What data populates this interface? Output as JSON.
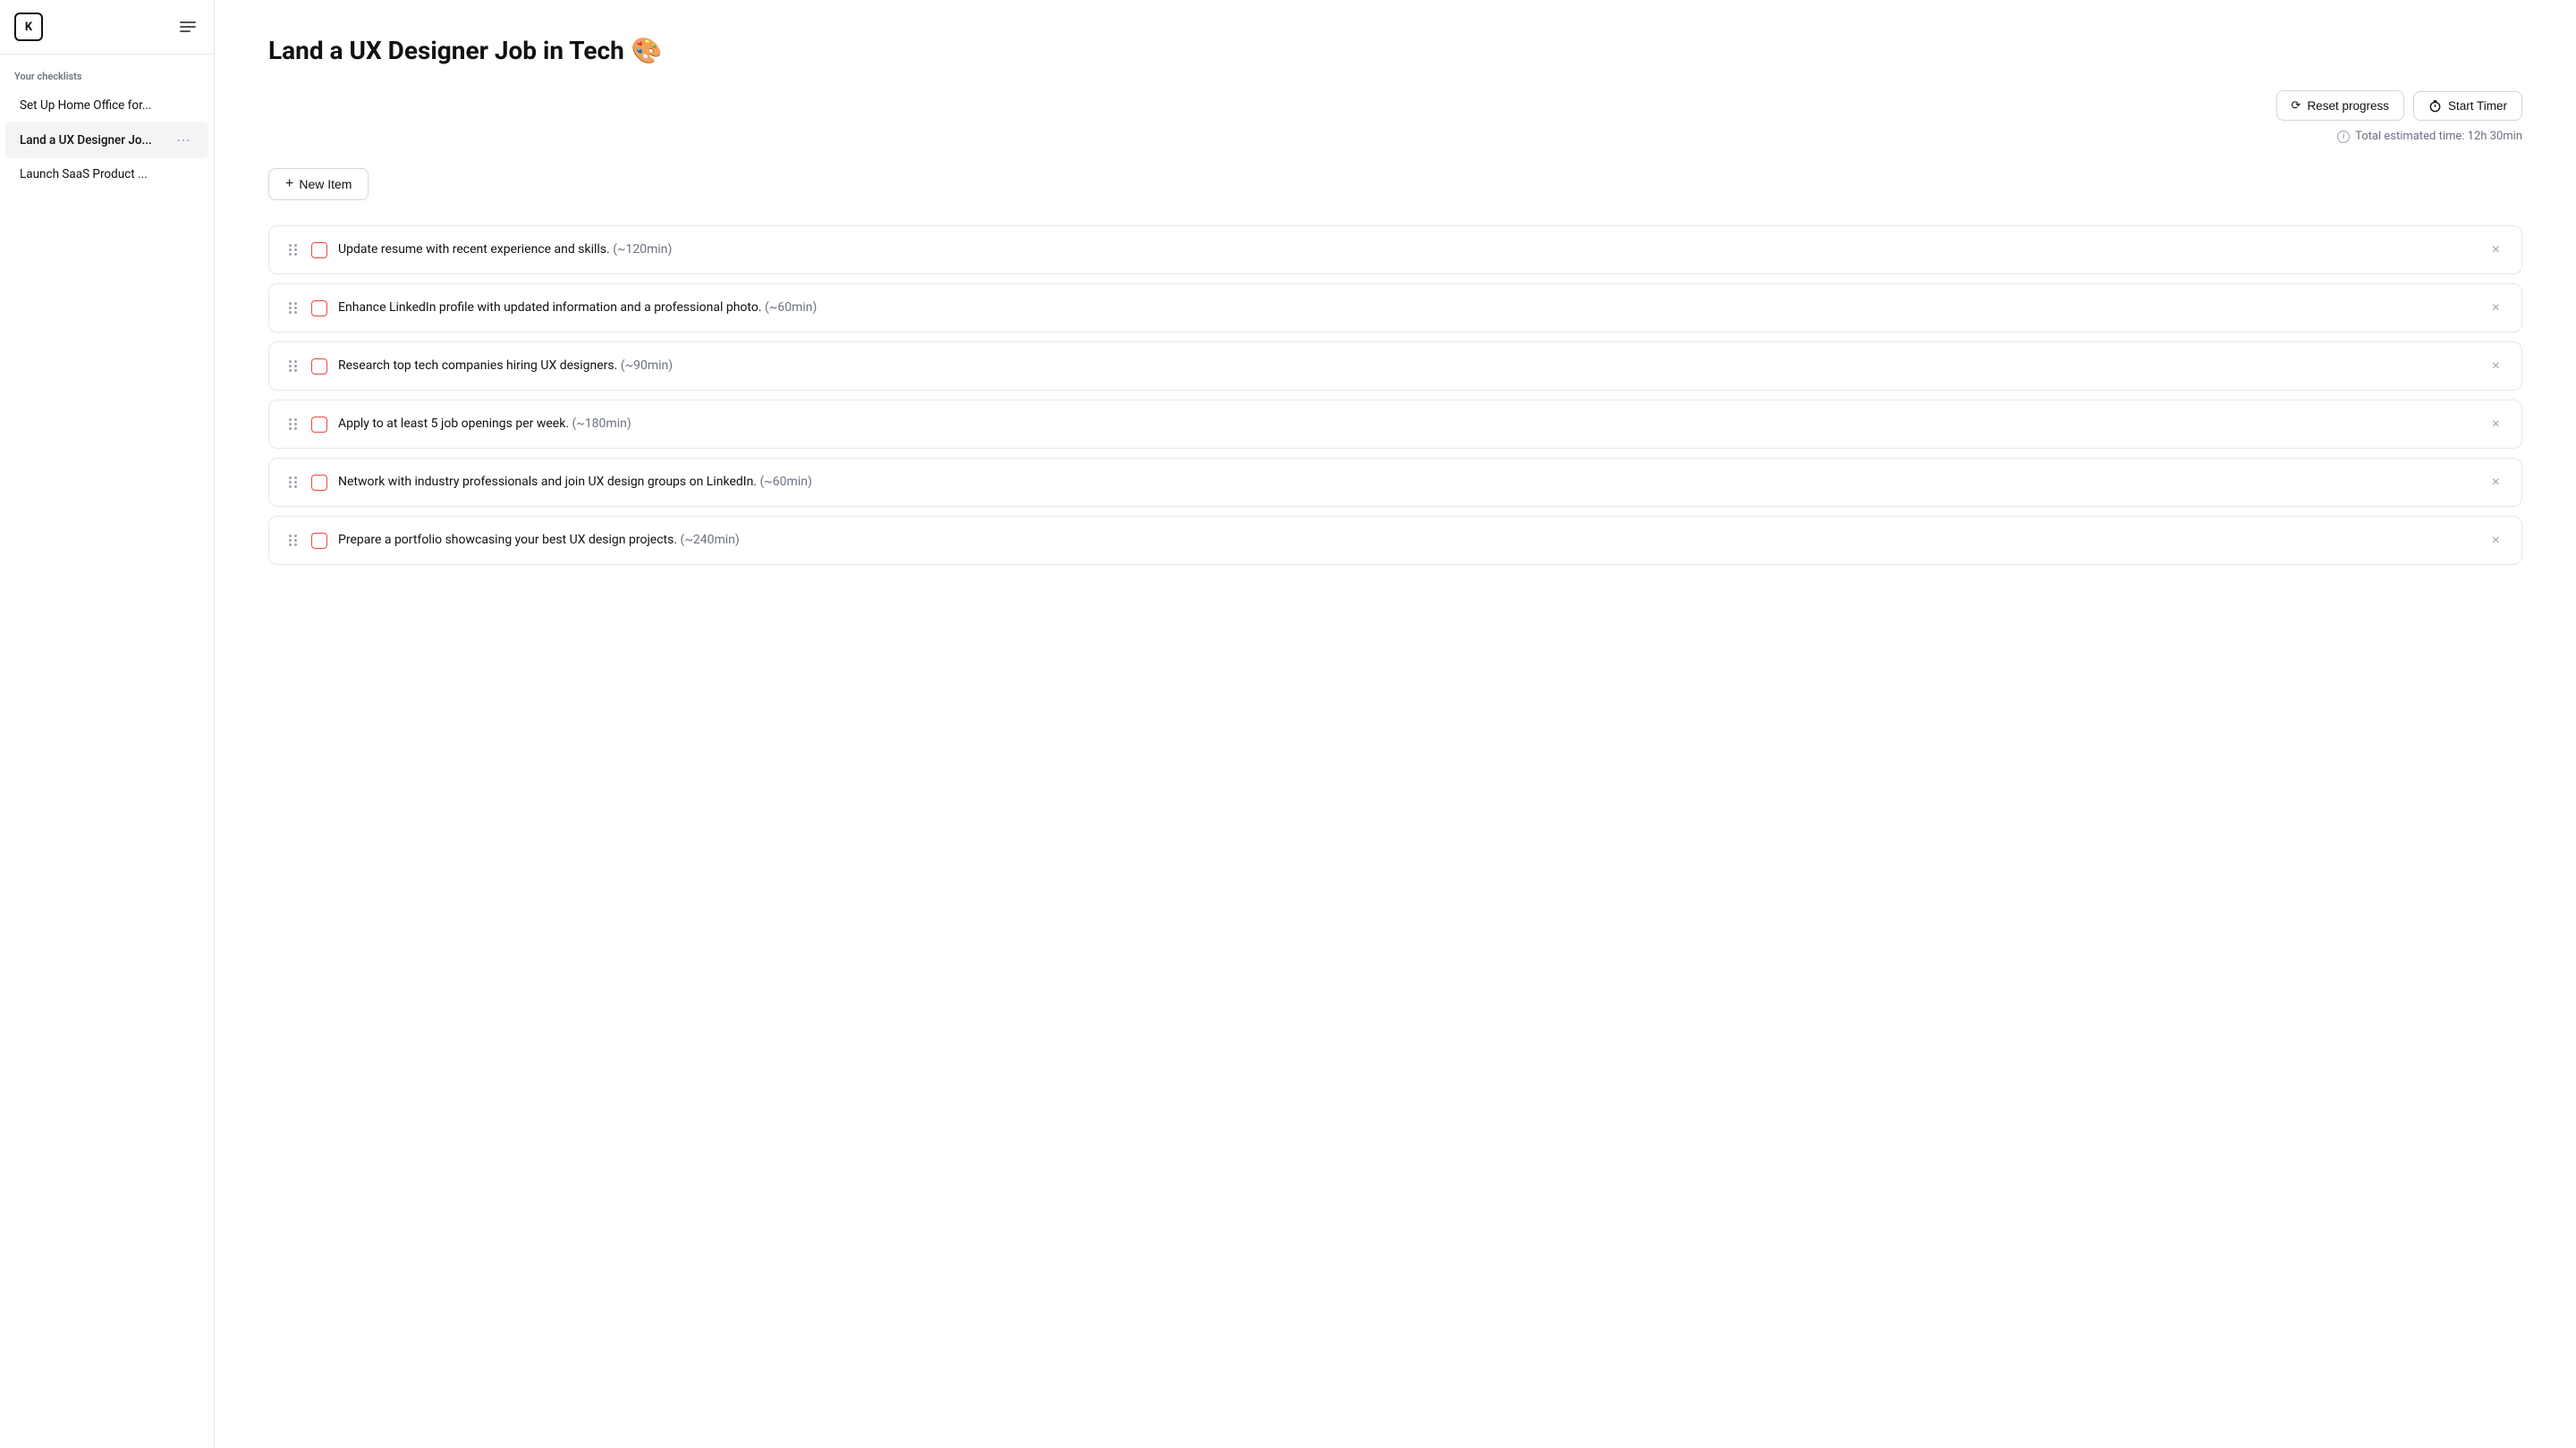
{
  "sidebar": {
    "logo": "K",
    "section_title": "Your checklists",
    "items": [
      {
        "id": "home-office",
        "label": "Set Up Home Office for...",
        "active": false
      },
      {
        "id": "ux-designer",
        "label": "Land a UX Designer Jo...",
        "active": true
      },
      {
        "id": "saas-product",
        "label": "Launch SaaS Product ...",
        "active": false
      }
    ]
  },
  "main": {
    "title": "Land a UX Designer Job in Tech",
    "title_emoji": "🎨",
    "toolbar": {
      "reset_label": "Reset progress",
      "timer_label": "Start Timer"
    },
    "estimated_time": "Total estimated time: 12h 30min",
    "new_item_label": "New Item",
    "checklist_items": [
      {
        "id": 1,
        "text": "Update resume with recent experience and skills.",
        "time": "(~120min)",
        "checked": false
      },
      {
        "id": 2,
        "text": "Enhance LinkedIn profile with updated information and a professional photo.",
        "time": "(~60min)",
        "checked": false
      },
      {
        "id": 3,
        "text": "Research top tech companies hiring UX designers.",
        "time": "(~90min)",
        "checked": false
      },
      {
        "id": 4,
        "text": "Apply to at least 5 job openings per week.",
        "time": "(~180min)",
        "checked": false
      },
      {
        "id": 5,
        "text": "Network with industry professionals and join UX design groups on LinkedIn.",
        "time": "(~60min)",
        "checked": false
      },
      {
        "id": 6,
        "text": "Prepare a portfolio showcasing your best UX design projects.",
        "time": "(~240min)",
        "checked": false
      }
    ]
  }
}
